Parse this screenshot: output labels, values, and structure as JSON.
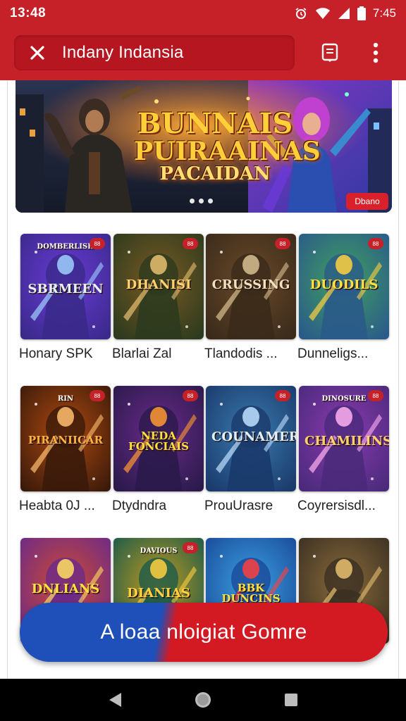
{
  "status_bar": {
    "time": "13:48",
    "right_time": "7:45"
  },
  "app_bar": {
    "title": "Indany Indansia",
    "close_icon": "close-icon",
    "bookmark_icon": "bookmark-icon",
    "more_icon": "more-vert-icon"
  },
  "banner": {
    "title_line1": "BUNNAIS",
    "title_line2": "PUIRAAINAS",
    "title_line3": "PACAIDAN",
    "badge": "Dbano",
    "slide_count": 3
  },
  "games": [
    {
      "caption": "Honary SPK",
      "tile_text": "SBRMEEN",
      "tile_top": "DOMBERLISH",
      "badge": "88"
    },
    {
      "caption": "Blarlai Zal",
      "tile_text": "DHANISI",
      "tile_top": "",
      "badge": "88"
    },
    {
      "caption": "Tlandodis ...",
      "tile_text": "CRUSSING",
      "tile_top": "",
      "badge": "88"
    },
    {
      "caption": "Dunneligs...",
      "tile_text": "DUODILS",
      "tile_top": "",
      "badge": "88"
    },
    {
      "caption": "Heabta 0J ...",
      "tile_text": "PIRANIICAR",
      "tile_top": "RIN",
      "badge": "88"
    },
    {
      "caption": "Dtydndra",
      "tile_text": "NEDA FONCIAIS",
      "tile_top": "",
      "badge": "88"
    },
    {
      "caption": "ProuUrasre",
      "tile_text": "COUNAMERS",
      "tile_top": "",
      "badge": "88"
    },
    {
      "caption": "Coyrersisdl...",
      "tile_text": "CHAMILINS",
      "tile_top": "DINOSURE",
      "badge": "88"
    },
    {
      "caption": "",
      "tile_text": "DNLIANS",
      "tile_top": "",
      "badge": ""
    },
    {
      "caption": "",
      "tile_text": "DIANIAS",
      "tile_top": "DAVIOUS",
      "badge": "88"
    },
    {
      "caption": "",
      "tile_text": "BBK DUNCINS",
      "tile_top": "",
      "badge": ""
    },
    {
      "caption": "",
      "tile_text": "",
      "tile_top": "",
      "badge": ""
    }
  ],
  "cta": {
    "label": "A loaa nloigiat Gomre"
  },
  "nav": {
    "back_icon": "back-triangle-icon",
    "home_icon": "home-circle-icon",
    "recents_icon": "recents-square-icon"
  },
  "colors": {
    "accent": "#c62028",
    "cta_blue": "#1f4fb8",
    "cta_red": "#d31a22"
  }
}
